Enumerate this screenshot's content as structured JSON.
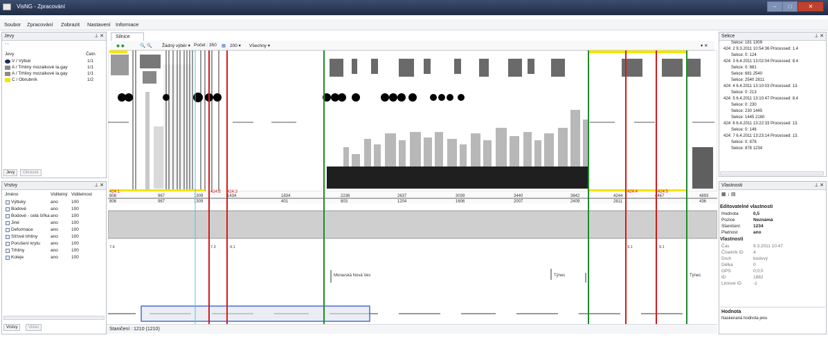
{
  "window": {
    "title": "VisNG - Zpracování",
    "controls": [
      "–",
      "□",
      "✕"
    ]
  },
  "menu": [
    "Soubor",
    "Zpracování",
    "Zobrazit",
    "Nastavení",
    "Informace"
  ],
  "left_top": {
    "title": "Jevy",
    "nav": "‹  ›",
    "col_name": "Jevy",
    "col_count": "Četn",
    "rows": [
      {
        "name": "V / Výtluk",
        "count": "1/1",
        "color": "#1c2a5a"
      },
      {
        "name": "A / Trhliny mozaikové la.gay",
        "count": "1/1",
        "color": "#8a8a8a"
      },
      {
        "name": "A / Trhliny mozaikové la.gay",
        "count": "1/1",
        "color": "#8a8a8a"
      },
      {
        "name": "C / Obrubník",
        "count": "1/2",
        "color": "#f5e400"
      }
    ],
    "tabs": [
      "Jevy",
      "Obrázek"
    ]
  },
  "left_bottom": {
    "title": "Vrstvy",
    "col_name": "Jméno",
    "col_vis": "Viditelný",
    "col_val": "Viditelnost",
    "rows": [
      {
        "name": "Výtluky",
        "vis": "ano",
        "val": "100"
      },
      {
        "name": "Bodové",
        "vis": "ano",
        "val": "100"
      },
      {
        "name": "Bodové - celá šířka",
        "vis": "ano",
        "val": "100"
      },
      {
        "name": "Jiné",
        "vis": "ano",
        "val": "100"
      },
      {
        "name": "Deformace",
        "vis": "ano",
        "val": "100"
      },
      {
        "name": "Síťové trhliny",
        "vis": "ano",
        "val": "100"
      },
      {
        "name": "Porušení krytu",
        "vis": "ano",
        "val": "100"
      },
      {
        "name": "Trhliny",
        "vis": "ano",
        "val": "100"
      },
      {
        "name": "Koleje",
        "vis": "ano",
        "val": "100"
      }
    ],
    "tabs": [
      "Vrstvy",
      "Video"
    ]
  },
  "doc": {
    "tab": "Silnice",
    "toolbar": {
      "nav": "◆ ◆",
      "zoom": "🔍 🔍",
      "selection": "Žádný výběr ▾",
      "count": "Počet : 350",
      "step": "200 ▾",
      "filter": "Všechny ▾",
      "close": "▾ ✕"
    },
    "scale_top": [
      {
        "a": "806",
        "b": "806"
      },
      {
        "a": "967",
        "b": "967"
      },
      {
        "a": "1309",
        "b": "1309"
      },
      {
        "a": "1434",
        "b": ""
      },
      {
        "a": "1834",
        "b": "401"
      },
      {
        "a": "2236",
        "b": "803"
      },
      {
        "a": "2637",
        "b": "1204"
      },
      {
        "a": "3039",
        "b": "1606"
      },
      {
        "a": "3440",
        "b": "2007"
      },
      {
        "a": "3842",
        "b": "2409"
      },
      {
        "a": "4244",
        "b": "2811"
      },
      {
        "a": "4467",
        "b": ""
      },
      {
        "a": "4893",
        "b": "436"
      }
    ],
    "red_labels": [
      "424:1",
      "424:2",
      "424:3",
      "424:4",
      "424:5"
    ],
    "small_values": [
      "7.6",
      "7.3",
      "9.1",
      "9.1",
      "9.1"
    ],
    "places": [
      "Moravská Nová Ves",
      "Týnec",
      "Týnec"
    ],
    "status": "Staničení : 1210 (1210)"
  },
  "right_top": {
    "title": "Sekce",
    "lines": [
      "Sekce: 181 1309",
      "424: 2  9.3.2011 10:54:36 Processed: 1.4",
      "Sekce: 0: 124",
      "424: 3  6.4.2011 13:02:04 Processed: 8.4",
      "Sekce: 0: 681",
      "Sekce: 681 2540",
      "Sekce: 2540 2811",
      "424: 4  6.4.2011 13:10:03 Processed: 13.",
      "Sekce: 0: 213",
      "424: 5  6.4.2011 13:10:47 Processed: 8.4",
      "Sekce: 0: 230",
      "Sekce: 230 1445",
      "Sekce: 1445 2160",
      "424: 6  6.4.2011 13:22:33 Processed: 13.",
      "Sekce: 0: 146",
      "424: 7  6.4.2011 13:23:14 Processed: 13.",
      "Sekce: 0: 878",
      "Sekce: 878 1234"
    ]
  },
  "right_bottom": {
    "title": "Vlastnosti",
    "group1": "Editovatelné vlastnosti",
    "editable": [
      {
        "k": "Hodnota",
        "v": "0,5"
      },
      {
        "k": "Pozice",
        "v": "Neznámá"
      },
      {
        "k": "Staničení",
        "v": "1234"
      },
      {
        "k": "Platnost",
        "v": "ano"
      }
    ],
    "group2": "Vlastnosti",
    "props": [
      {
        "k": "Čas",
        "v": "9.3.2011 10:47"
      },
      {
        "k": "Číselník ID",
        "v": "4"
      },
      {
        "k": "Druh",
        "v": "bodový"
      },
      {
        "k": "Délka",
        "v": "0"
      },
      {
        "k": "GPS",
        "v": "0;0;0"
      },
      {
        "k": "ID",
        "v": "1882"
      },
      {
        "k": "Liniové ID",
        "v": "-1"
      }
    ],
    "help_title": "Hodnota",
    "help_text": "Naskenaná hodnota jevu"
  },
  "colors": {
    "red": "#d21a1a",
    "green": "#1f8a2a",
    "yellow": "#f5e400",
    "blue": "#4a6fd0",
    "cyan": "#47c8e6"
  }
}
